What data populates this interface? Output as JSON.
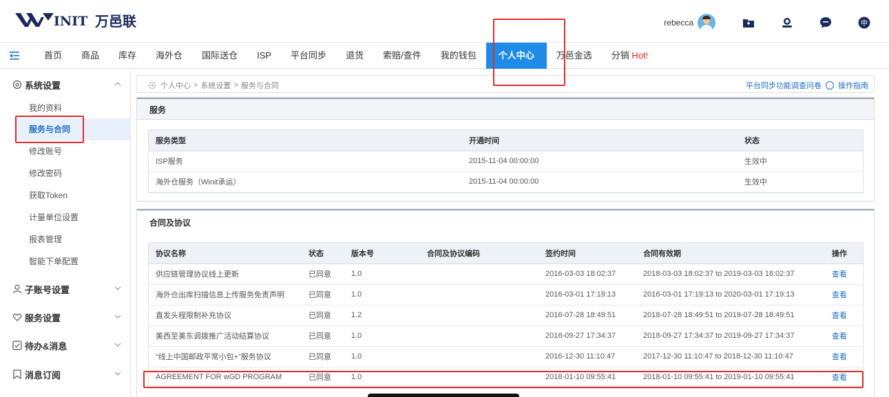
{
  "brand": {
    "logo_text": "万邑联",
    "logo_mark": "WINIT"
  },
  "header": {
    "username": "rebecca",
    "icons": [
      "folder-icon",
      "support-icon",
      "chat-icon",
      "language-icon"
    ],
    "language_label": "中"
  },
  "nav": {
    "items": [
      {
        "label": "首页"
      },
      {
        "label": "商品"
      },
      {
        "label": "库存"
      },
      {
        "label": "海外仓"
      },
      {
        "label": "国际送仓"
      },
      {
        "label": "ISP"
      },
      {
        "label": "平台同步"
      },
      {
        "label": "退货"
      },
      {
        "label": "索赔/查件"
      },
      {
        "label": "我的钱包"
      },
      {
        "label": "个人中心"
      },
      {
        "label": "万邑金选"
      },
      {
        "label": "分销",
        "hot": "Hot!"
      }
    ],
    "active_index": 10
  },
  "sidebar": {
    "group1": {
      "label": "系统设置",
      "items": [
        "我的资料",
        "服务与合同",
        "修改账号",
        "修改密码",
        "获取Token",
        "计量单位设置",
        "报表管理",
        "智能下单配置"
      ]
    },
    "group2": {
      "label": "子账号设置"
    },
    "group3": {
      "label": "服务设置"
    },
    "group4": {
      "label": "待办&消息"
    },
    "group5": {
      "label": "消息订阅"
    }
  },
  "breadcrumb": {
    "items": [
      "个人中心",
      "系统设置",
      "服务与合同"
    ],
    "sep": ">",
    "right_link": "平台同步功能调查问卷",
    "right_link2": "操作指南"
  },
  "services": {
    "title": "服务",
    "headers": [
      "服务类型",
      "开通时间",
      "状态"
    ],
    "rows": [
      [
        "ISP服务",
        "2015-11-04 00:00:00",
        "生效中"
      ],
      [
        "海外仓服务（Winit承运）",
        "2015-11-04 00:00:00",
        "生效中"
      ]
    ]
  },
  "contracts": {
    "title": "合同及协议",
    "headers": [
      "协议名称",
      "状态",
      "版本号",
      "合同及协议编码",
      "签约时间",
      "合同有效期",
      "操作"
    ],
    "rows": [
      [
        "供应链管理协议线上更新",
        "已同意",
        "1.0",
        "",
        "2016-03-03 18:02:37",
        "2018-03-03 18:02:37 to 2019-03-03 18:02:37",
        "查看"
      ],
      [
        "海外仓出库扫描信息上传服务免责声明",
        "已同意",
        "1.0",
        "",
        "2016-03-01 17:19:13",
        "2016-03-01 17:19:13 to 2020-03-01 17:19:13",
        "查看"
      ],
      [
        "直发头程限制补充协议",
        "已同意",
        "1.2",
        "",
        "2016-07-28 18:49:51",
        "2018-07-28 18:49:51 to 2019-07-28 18:49:51",
        "查看"
      ],
      [
        "美西至美东调拨推广活动结算协议",
        "已同意",
        "1.0",
        "",
        "2016-09-27 17:34:37",
        "2018-09-27 17:34:37 to 2019-09-27 17:34:37",
        "查看"
      ],
      [
        "“线上中国邮政平常小包+”服务协议",
        "已同意",
        "1.0",
        "",
        "2016-12-30 11:10:47",
        "2017-12-30 11:10:47 to 2018-12-30 11:10:47",
        "查看"
      ],
      [
        "AGREEMENT FOR wGD PROGRAM",
        "已同意",
        "1.0",
        "",
        "2018-01-10 09:55:41",
        "2018-01-10 09:55:41 to 2019-01-10 09:55:41",
        "查看"
      ]
    ]
  },
  "colors": {
    "accent": "#1e8ce6",
    "highlight": "#e02a2a",
    "hot": "#e02020"
  }
}
